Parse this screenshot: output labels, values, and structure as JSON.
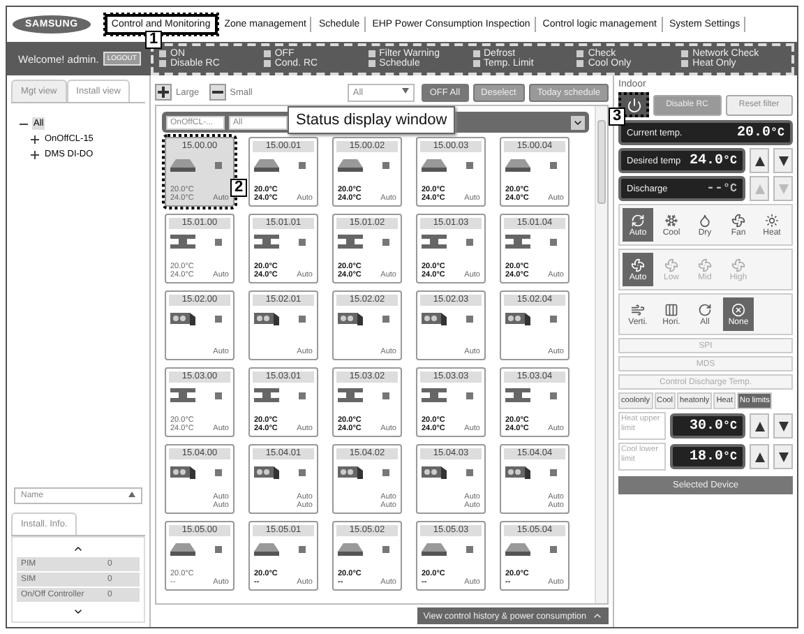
{
  "logo": "SAMSUNG",
  "nav": [
    {
      "label": "Control and Monitoring",
      "selected": true
    },
    {
      "label": "Zone management",
      "selected": false
    },
    {
      "label": "Schedule",
      "selected": false
    },
    {
      "label": "EHP Power Consumption Inspection",
      "selected": false
    },
    {
      "label": "Control logic management",
      "selected": false
    },
    {
      "label": "System Settings",
      "selected": false
    }
  ],
  "welcome": "Welcome! admin.",
  "logout": "LOGOUT",
  "legend": [
    "ON",
    "OFF",
    "Filter Warning",
    "Defrost",
    "Check",
    "Network Check",
    "Disable RC",
    "Cond. RC",
    "Schedule",
    "Temp. Limit",
    "Cool Only",
    "Heat Only"
  ],
  "left": {
    "tabs": [
      {
        "label": "Mgt view",
        "selected": true
      },
      {
        "label": "Install view",
        "selected": false
      }
    ],
    "tree": [
      {
        "label": "All",
        "expanded": true,
        "selected": true,
        "children": [
          {
            "label": "OnOffCL-15",
            "expanded": false,
            "selected": false
          },
          {
            "label": "DMS DI-DO",
            "expanded": false,
            "selected": false
          }
        ]
      }
    ],
    "sort": "Name",
    "info_tab": "Install. Info.",
    "info_rows": [
      {
        "name": "PIM",
        "count": "0"
      },
      {
        "name": "SIM",
        "count": "0"
      },
      {
        "name": "On/Off Controller",
        "count": "0"
      }
    ]
  },
  "toolbar": {
    "large": "Large",
    "small": "Small",
    "filter": "All",
    "buttons": [
      "OFF All",
      "Deselect",
      "Today schedule"
    ]
  },
  "grid_header": {
    "group": "OnOffCL-...",
    "filter": "All"
  },
  "cards": [
    {
      "id": "15.00.00",
      "kind": "cassette",
      "selected": true,
      "active": false,
      "temps": [
        "20.0°C",
        "24.0°C"
      ],
      "modes": [
        "Auto"
      ]
    },
    {
      "id": "15.00.01",
      "kind": "cassette",
      "selected": false,
      "active": true,
      "temps": [
        "20.0°C",
        "24.0°C"
      ],
      "modes": [
        "Auto"
      ]
    },
    {
      "id": "15.00.02",
      "kind": "cassette",
      "selected": false,
      "active": true,
      "temps": [
        "20.0°C",
        "24.0°C"
      ],
      "modes": [
        "Auto"
      ]
    },
    {
      "id": "15.00.03",
      "kind": "cassette",
      "selected": false,
      "active": true,
      "temps": [
        "20.0°C",
        "24.0°C"
      ],
      "modes": [
        "Auto"
      ]
    },
    {
      "id": "15.00.04",
      "kind": "cassette",
      "selected": false,
      "active": true,
      "temps": [
        "20.0°C",
        "24.0°C"
      ],
      "modes": [
        "Auto"
      ]
    },
    {
      "id": "15.01.00",
      "kind": "duct",
      "selected": false,
      "active": false,
      "temps": [
        "20.0°C",
        "24.0°C"
      ],
      "modes": [
        "Auto"
      ]
    },
    {
      "id": "15.01.01",
      "kind": "duct",
      "selected": false,
      "active": true,
      "temps": [
        "20.0°C",
        "24.0°C"
      ],
      "modes": [
        "Auto"
      ]
    },
    {
      "id": "15.01.02",
      "kind": "duct",
      "selected": false,
      "active": true,
      "temps": [
        "20.0°C",
        "24.0°C"
      ],
      "modes": [
        "Auto"
      ]
    },
    {
      "id": "15.01.03",
      "kind": "duct",
      "selected": false,
      "active": true,
      "temps": [
        "20.0°C",
        "24.0°C"
      ],
      "modes": [
        "Auto"
      ]
    },
    {
      "id": "15.01.04",
      "kind": "duct",
      "selected": false,
      "active": true,
      "temps": [
        "20.0°C",
        "24.0°C"
      ],
      "modes": [
        "Auto"
      ]
    },
    {
      "id": "15.02.00",
      "kind": "box",
      "selected": false,
      "modes": [
        "Auto"
      ]
    },
    {
      "id": "15.02.01",
      "kind": "box",
      "selected": false,
      "modes": [
        "Auto"
      ]
    },
    {
      "id": "15.02.02",
      "kind": "box",
      "selected": false,
      "modes": [
        "Auto"
      ]
    },
    {
      "id": "15.02.03",
      "kind": "box",
      "selected": false,
      "modes": [
        "Auto"
      ]
    },
    {
      "id": "15.02.04",
      "kind": "box",
      "selected": false,
      "modes": [
        "Auto"
      ]
    },
    {
      "id": "15.03.00",
      "kind": "duct",
      "selected": false,
      "active": false,
      "temps": [
        "20.0°C",
        "24.0°C"
      ],
      "modes": [
        "Auto"
      ]
    },
    {
      "id": "15.03.01",
      "kind": "duct",
      "selected": false,
      "active": true,
      "temps": [
        "20.0°C",
        "24.0°C"
      ],
      "modes": [
        "Auto"
      ]
    },
    {
      "id": "15.03.02",
      "kind": "duct",
      "selected": false,
      "active": true,
      "temps": [
        "20.0°C",
        "24.0°C"
      ],
      "modes": [
        "Auto"
      ]
    },
    {
      "id": "15.03.03",
      "kind": "duct",
      "selected": false,
      "active": true,
      "temps": [
        "20.0°C",
        "24.0°C"
      ],
      "modes": [
        "Auto"
      ]
    },
    {
      "id": "15.03.04",
      "kind": "duct",
      "selected": false,
      "active": true,
      "temps": [
        "20.0°C",
        "24.0°C"
      ],
      "modes": [
        "Auto"
      ]
    },
    {
      "id": "15.04.00",
      "kind": "box",
      "selected": false,
      "modes": [
        "Auto",
        "Auto"
      ]
    },
    {
      "id": "15.04.01",
      "kind": "box",
      "selected": false,
      "modes": [
        "Auto",
        "Auto"
      ]
    },
    {
      "id": "15.04.02",
      "kind": "box",
      "selected": false,
      "modes": [
        "Auto",
        "Auto"
      ]
    },
    {
      "id": "15.04.03",
      "kind": "box",
      "selected": false,
      "modes": [
        "Auto",
        "Auto"
      ]
    },
    {
      "id": "15.04.04",
      "kind": "box",
      "selected": false,
      "modes": [
        "Auto",
        "Auto"
      ]
    },
    {
      "id": "15.05.00",
      "kind": "cassette",
      "selected": false,
      "active": false,
      "temps": [
        "20.0°C",
        "--"
      ],
      "modes": [
        "Auto"
      ]
    },
    {
      "id": "15.05.01",
      "kind": "cassette",
      "selected": false,
      "active": true,
      "temps": [
        "20.0°C",
        "--"
      ],
      "modes": [
        "Auto"
      ]
    },
    {
      "id": "15.05.02",
      "kind": "cassette",
      "selected": false,
      "active": true,
      "temps": [
        "20.0°C",
        "--"
      ],
      "modes": [
        "Auto"
      ]
    },
    {
      "id": "15.05.03",
      "kind": "cassette",
      "selected": false,
      "active": true,
      "temps": [
        "20.0°C",
        "--"
      ],
      "modes": [
        "Auto"
      ]
    },
    {
      "id": "15.05.04",
      "kind": "cassette",
      "selected": false,
      "active": true,
      "temps": [
        "20.0°C",
        "--"
      ],
      "modes": [
        "Auto"
      ]
    }
  ],
  "history_button": "View control history & power consumption",
  "indoor": {
    "title": "Indoor",
    "power_selected": true,
    "buttons": [
      "Disable RC",
      "Reset filter"
    ],
    "displays": [
      {
        "label": "Current temp.",
        "value": "20.0",
        "unit": "°C",
        "adjustable": false,
        "disabled": false
      },
      {
        "label": "Desired temp",
        "value": "24.0",
        "unit": "°C",
        "adjustable": true,
        "disabled": false
      },
      {
        "label": "Discharge",
        "value": "--",
        "unit": "°C",
        "adjustable": true,
        "disabled": true
      }
    ],
    "modes": [
      {
        "label": "Auto",
        "selected": true
      },
      {
        "label": "Cool",
        "selected": false
      },
      {
        "label": "Dry",
        "selected": false
      },
      {
        "label": "Fan",
        "selected": false
      },
      {
        "label": "Heat",
        "selected": false
      }
    ],
    "fan": [
      {
        "label": "Auto",
        "selected": true,
        "disabled": false
      },
      {
        "label": "Low",
        "selected": false,
        "disabled": true
      },
      {
        "label": "Mid",
        "selected": false,
        "disabled": true
      },
      {
        "label": "High",
        "selected": false,
        "disabled": true
      }
    ],
    "louver": [
      {
        "label": "Verti.",
        "selected": false
      },
      {
        "label": "Hori.",
        "selected": false
      },
      {
        "label": "All",
        "selected": false
      },
      {
        "label": "None",
        "selected": true
      }
    ],
    "wide_buttons": [
      "SPI",
      "MDS",
      "Control Discharge Temp."
    ],
    "limit_tabs": [
      {
        "label": "coolonly",
        "selected": false
      },
      {
        "label": "Cool",
        "selected": false
      },
      {
        "label": "heatonly",
        "selected": false
      },
      {
        "label": "Heat",
        "selected": false
      },
      {
        "label": "No limits",
        "selected": true
      }
    ],
    "limits": [
      {
        "label": "Heat upper limit",
        "value": "30.0",
        "unit": "°C"
      },
      {
        "label": "Cool lower limit",
        "value": "18.0",
        "unit": "°C"
      }
    ],
    "selected_device": "Selected Device"
  },
  "callouts": [
    "1",
    "2",
    "3"
  ],
  "status_callout": "Status display window"
}
